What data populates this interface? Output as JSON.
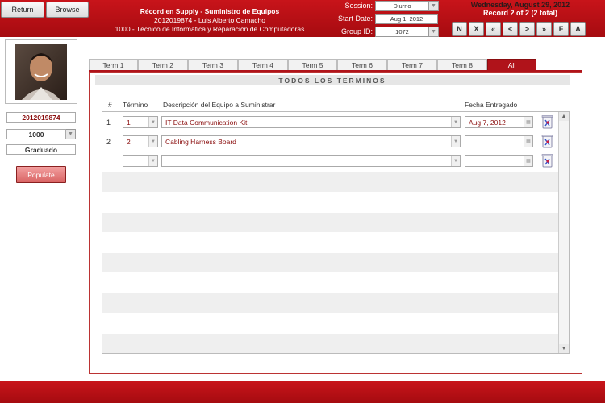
{
  "header": {
    "return_label": "Return",
    "browse_label": "Browse",
    "title": "Récord en Supply - Suministro de Equipos",
    "student_line": "2012019874 - Luis Alberto Camacho",
    "program_line": "1000 - Técnico de Informática y Reparación de Computadoras",
    "session_label": "Session:",
    "session_value": "Diurno",
    "start_date_label": "Start Date:",
    "start_date_value": "Aug 1, 2012",
    "group_id_label": "Group ID:",
    "group_id_value": "1072",
    "date_text": "Wednesday, August 29, 2012",
    "record_text": "Record 2 of 2 (2 total)",
    "nav_buttons": [
      "N",
      "X",
      "«",
      "<",
      ">",
      "»",
      "F",
      "A"
    ]
  },
  "left": {
    "student_id": "2012019874",
    "program": "1000",
    "status": "Graduado",
    "populate_label": "Populate"
  },
  "tabs": [
    "Term 1",
    "Term 2",
    "Term 3",
    "Term 4",
    "Term 5",
    "Term 6",
    "Term 7",
    "Term 8",
    "All"
  ],
  "active_tab": "All",
  "section_title": "TODOS LOS TERMINOS",
  "columns": {
    "num": "#",
    "term": "Término",
    "description": "Descripción del Equipo a Suministrar",
    "date": "Fecha Entregado"
  },
  "rows": [
    {
      "num": "1",
      "term": "1",
      "description": "IT Data Communication Kit",
      "date": "Aug 7, 2012"
    },
    {
      "num": "2",
      "term": "2",
      "description": "Cabling Harness Board",
      "date": ""
    },
    {
      "num": "",
      "term": "",
      "description": "",
      "date": ""
    }
  ],
  "colors": {
    "brand": "#b0131a",
    "text_red": "#8a0d0d"
  },
  "icons": {
    "trash": "trash-icon",
    "calendar": "calendar-icon",
    "dropdown": "chevron-down-icon"
  }
}
